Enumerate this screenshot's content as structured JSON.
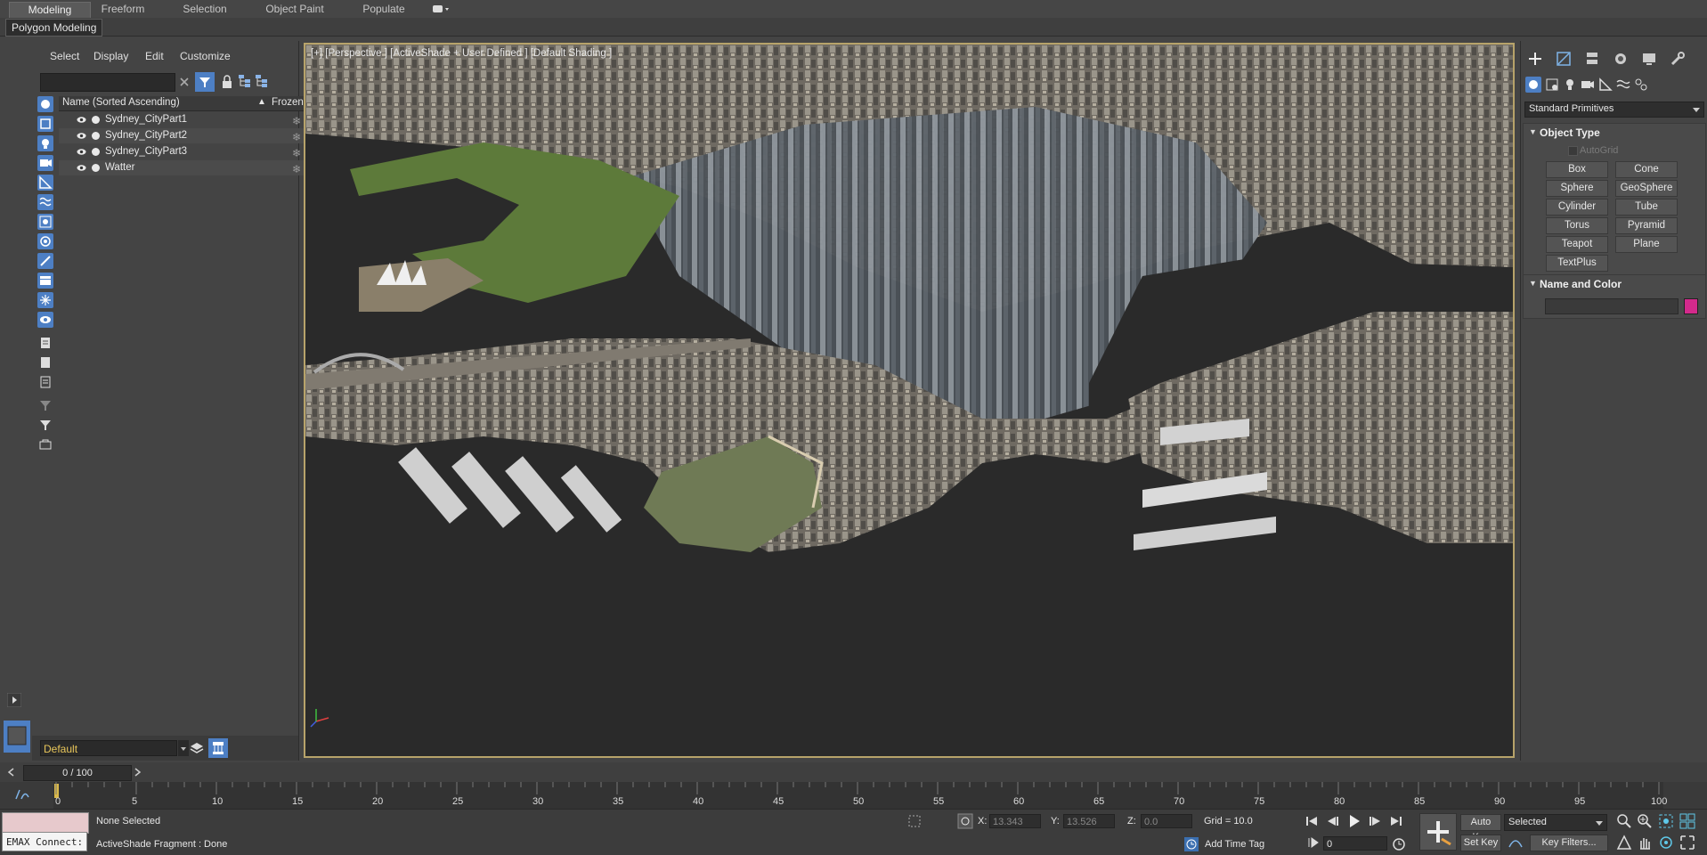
{
  "ribbon": {
    "tabs": [
      "Modeling",
      "Freeform",
      "Selection",
      "Object Paint",
      "Populate"
    ],
    "sub_button": "Polygon Modeling"
  },
  "explorer": {
    "menu": [
      "Select",
      "Display",
      "Edit",
      "Customize"
    ],
    "columns": {
      "name": "Name (Sorted Ascending)",
      "frozen": "Frozen",
      "sort_indicator": "▲"
    },
    "rows": [
      "Sydney_CityPart1",
      "Sydney_CityPart2",
      "Sydney_CityPart3",
      "Watter"
    ],
    "layer": "Default"
  },
  "viewport": {
    "label": "[+] [Perspective ] [ActiveShade + User Defined ] [Default Shading ]"
  },
  "command_panel": {
    "dropdown": "Standard Primitives",
    "object_type_title": "Object Type",
    "autogrid": "AutoGrid",
    "buttons": [
      "Box",
      "Cone",
      "Sphere",
      "GeoSphere",
      "Cylinder",
      "Tube",
      "Torus",
      "Pyramid",
      "Teapot",
      "Plane",
      "TextPlus"
    ],
    "name_color_title": "Name and Color",
    "object_color": "#d42a8c"
  },
  "timeline": {
    "frame": "0 / 100",
    "ticks": [
      "5",
      "10",
      "15",
      "20",
      "25",
      "30",
      "35",
      "40",
      "45",
      "50",
      "55",
      "60",
      "65",
      "70",
      "75",
      "80",
      "85",
      "90",
      "95",
      "100"
    ],
    "zero": "0"
  },
  "status": {
    "script_box": "EMAX Connect:",
    "selection": "None Selected",
    "prompt": "ActiveShade Fragment : Done",
    "x_label": "X:",
    "x_value": "13.343",
    "y_label": "Y:",
    "y_value": "13.526",
    "z_label": "Z:",
    "z_value": "0.0",
    "grid": "Grid = 10.0",
    "add_time_tag": "Add Time Tag",
    "auto_key": "Auto Key",
    "set_key": "Set Key",
    "key_mode": "Selected",
    "key_filters": "Key Filters...",
    "current_frame": "0"
  },
  "colors": {
    "accent_blue": "#4d7fc4",
    "viewport_border": "#b7a36a",
    "layer_text": "#e8c65a"
  }
}
